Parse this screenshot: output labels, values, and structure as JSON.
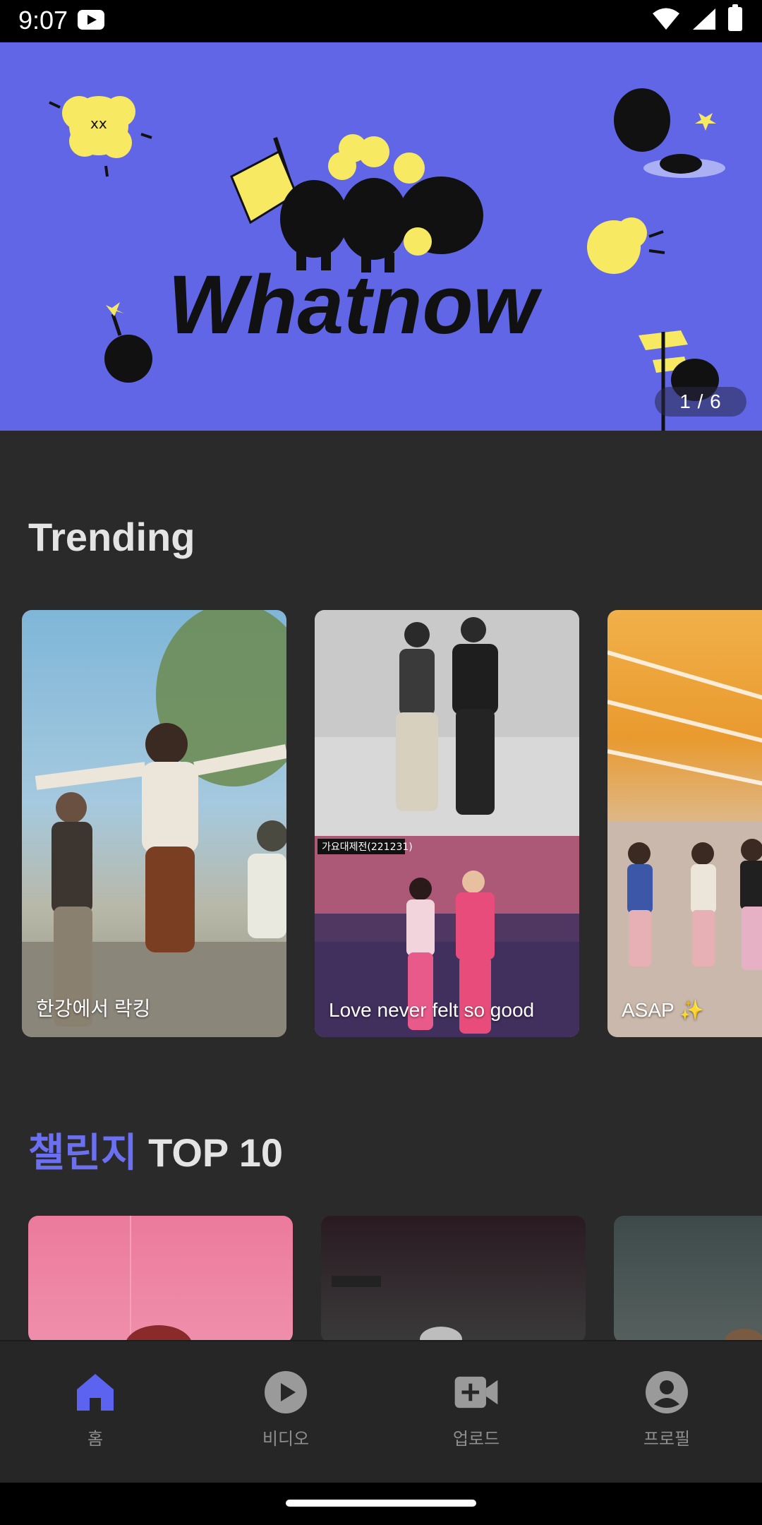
{
  "status_bar": {
    "time": "9:07",
    "icons": [
      "youtube-notification-icon",
      "wifi-icon",
      "signal-icon",
      "battery-icon"
    ]
  },
  "banner": {
    "logo_text": "Whatnow",
    "counter": "1 / 6",
    "background_color": "#6066e6"
  },
  "trending": {
    "title": "Trending",
    "items": [
      {
        "caption": "한강에서 락킹"
      },
      {
        "caption": "Love never felt so good",
        "overlay_tag": "가요대제전(221231)"
      },
      {
        "caption": "ASAP ✨"
      }
    ]
  },
  "challenge": {
    "title_accent": "챌린지",
    "title_rest": " TOP 10",
    "accent_color": "#6b70f0"
  },
  "bottom_nav": {
    "items": [
      {
        "label": "홈",
        "icon": "home-icon",
        "active": true
      },
      {
        "label": "비디오",
        "icon": "play-circle-icon",
        "active": false
      },
      {
        "label": "업로드",
        "icon": "video-add-icon",
        "active": false
      },
      {
        "label": "프로필",
        "icon": "account-circle-icon",
        "active": false
      }
    ],
    "active_color": "#5b63f0"
  }
}
